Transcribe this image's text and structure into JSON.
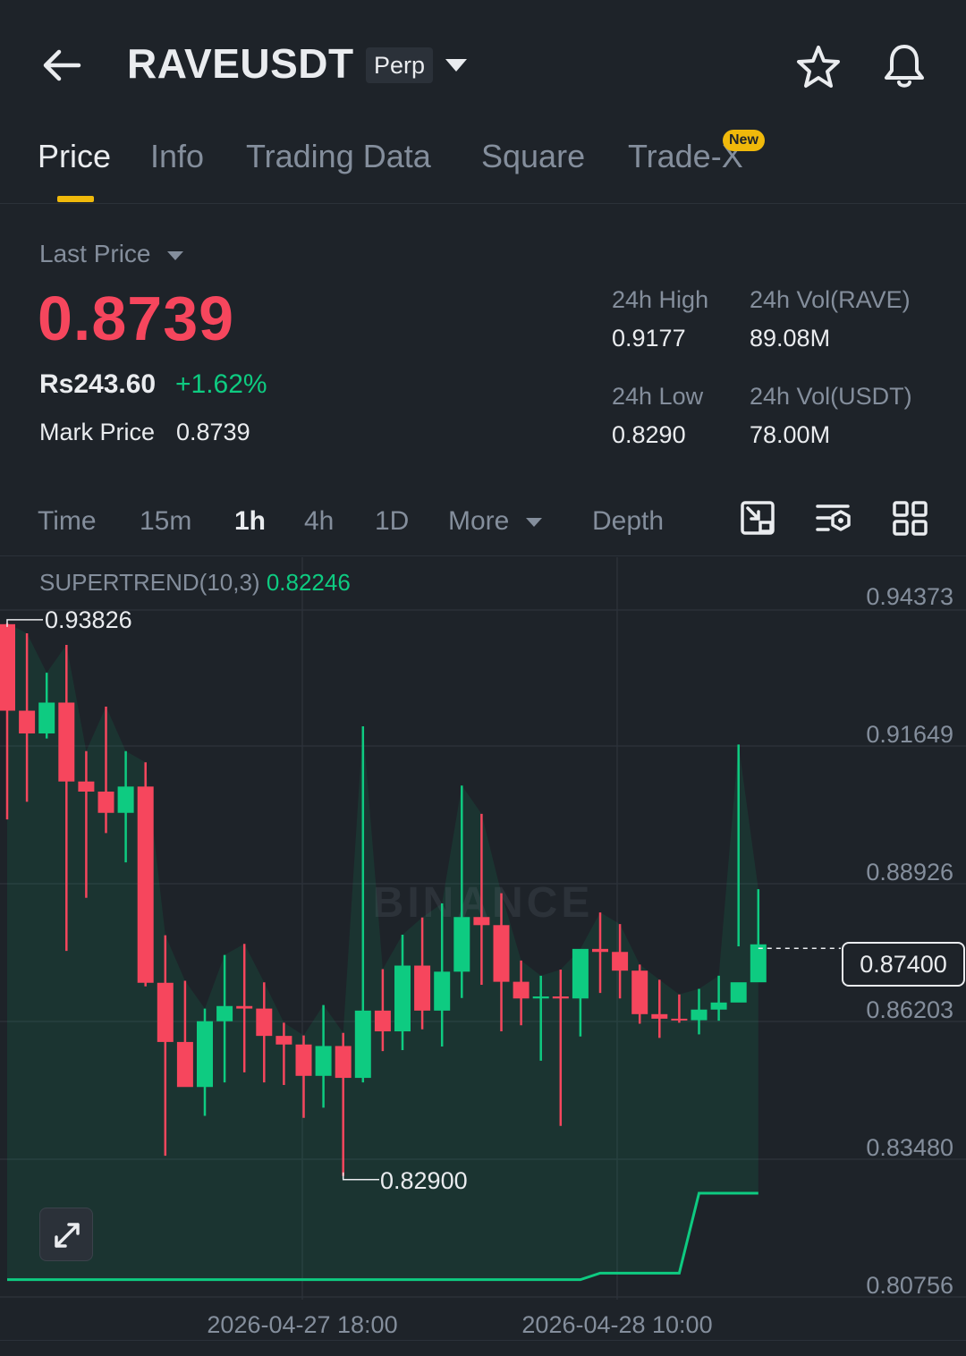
{
  "header": {
    "symbol": "RAVEUSDT",
    "contract_type": "Perp",
    "icons": [
      "back-arrow-icon",
      "chevron-down-icon",
      "star-icon",
      "bell-icon"
    ]
  },
  "tabs": [
    {
      "label": "Price",
      "active": true
    },
    {
      "label": "Info",
      "active": false
    },
    {
      "label": "Trading Data",
      "active": false
    },
    {
      "label": "Square",
      "active": false
    },
    {
      "label": "Trade-X",
      "active": false,
      "badge": "New"
    }
  ],
  "price_panel": {
    "label": "Last Price",
    "last_price": "0.8739",
    "fiat_value": "Rs243.60",
    "change_percent": "+1.62%",
    "mark_price_label": "Mark Price",
    "mark_price": "0.8739",
    "stats": {
      "high_label": "24h High",
      "high_value": "0.9177",
      "vol_base_label": "24h Vol(RAVE)",
      "vol_base_value": "89.08M",
      "low_label": "24h Low",
      "low_value": "0.8290",
      "vol_quote_label": "24h Vol(USDT)",
      "vol_quote_value": "78.00M"
    }
  },
  "intervals": {
    "items": [
      "Time",
      "15m",
      "1h",
      "4h",
      "1D",
      "More",
      "Depth"
    ],
    "active": "1h",
    "tool_icons": [
      "chart-tools-icon",
      "indicator-settings-icon",
      "layout-grid-icon"
    ]
  },
  "colors": {
    "up": "#0ecb81",
    "down": "#f6465d",
    "accent": "#f0b90b",
    "background": "#1e2329"
  },
  "chart_data": {
    "type": "candlestick",
    "indicator": {
      "name": "SUPERTREND(10,3)",
      "value": "0.82246"
    },
    "watermark": "BINANCE",
    "y_axis_ticks": [
      "0.94373",
      "0.91649",
      "0.88926",
      "0.86203",
      "0.83480",
      "0.80756"
    ],
    "ylim": [
      0.80756,
      0.94373
    ],
    "x_axis_ticks": [
      "2026-04-27 18:00",
      "2026-04-28 10:00"
    ],
    "current_price_tag": "0.87400",
    "high_annotation": "0.93826",
    "low_annotation": "0.82900",
    "candles": [
      {
        "o": 0.9381,
        "h": 0.9383,
        "l": 0.8995,
        "c": 0.921
      },
      {
        "o": 0.921,
        "h": 0.9363,
        "l": 0.903,
        "c": 0.9165
      },
      {
        "o": 0.9165,
        "h": 0.9285,
        "l": 0.9155,
        "c": 0.9226
      },
      {
        "o": 0.9226,
        "h": 0.934,
        "l": 0.8735,
        "c": 0.907
      },
      {
        "o": 0.907,
        "h": 0.913,
        "l": 0.884,
        "c": 0.905
      },
      {
        "o": 0.905,
        "h": 0.9218,
        "l": 0.8968,
        "c": 0.9008
      },
      {
        "o": 0.9008,
        "h": 0.913,
        "l": 0.891,
        "c": 0.906
      },
      {
        "o": 0.906,
        "h": 0.9108,
        "l": 0.8665,
        "c": 0.8672
      },
      {
        "o": 0.8672,
        "h": 0.8766,
        "l": 0.833,
        "c": 0.8555
      },
      {
        "o": 0.8555,
        "h": 0.8676,
        "l": 0.851,
        "c": 0.8466
      },
      {
        "o": 0.8466,
        "h": 0.8621,
        "l": 0.8409,
        "c": 0.8596
      },
      {
        "o": 0.8596,
        "h": 0.8727,
        "l": 0.8475,
        "c": 0.8626
      },
      {
        "o": 0.8626,
        "h": 0.8749,
        "l": 0.8495,
        "c": 0.8621
      },
      {
        "o": 0.8621,
        "h": 0.8673,
        "l": 0.8475,
        "c": 0.8567
      },
      {
        "o": 0.8567,
        "h": 0.8593,
        "l": 0.847,
        "c": 0.855
      },
      {
        "o": 0.855,
        "h": 0.8568,
        "l": 0.8405,
        "c": 0.8488
      },
      {
        "o": 0.8488,
        "h": 0.8628,
        "l": 0.8425,
        "c": 0.8547
      },
      {
        "o": 0.8547,
        "h": 0.8573,
        "l": 0.829,
        "c": 0.8484
      },
      {
        "o": 0.8484,
        "h": 0.9179,
        "l": 0.8475,
        "c": 0.8617
      },
      {
        "o": 0.8617,
        "h": 0.8699,
        "l": 0.8537,
        "c": 0.8576
      },
      {
        "o": 0.8576,
        "h": 0.8767,
        "l": 0.8539,
        "c": 0.8706
      },
      {
        "o": 0.8706,
        "h": 0.8801,
        "l": 0.858,
        "c": 0.8617
      },
      {
        "o": 0.8617,
        "h": 0.8829,
        "l": 0.8546,
        "c": 0.8694
      },
      {
        "o": 0.8694,
        "h": 0.9062,
        "l": 0.8642,
        "c": 0.8802
      },
      {
        "o": 0.8802,
        "h": 0.9006,
        "l": 0.8668,
        "c": 0.8786
      },
      {
        "o": 0.8786,
        "h": 0.8849,
        "l": 0.8576,
        "c": 0.8674
      },
      {
        "o": 0.8674,
        "h": 0.8716,
        "l": 0.8588,
        "c": 0.8641
      },
      {
        "o": 0.8641,
        "h": 0.8686,
        "l": 0.8518,
        "c": 0.8645
      },
      {
        "o": 0.8645,
        "h": 0.8698,
        "l": 0.8389,
        "c": 0.8641
      },
      {
        "o": 0.8641,
        "h": 0.8703,
        "l": 0.8566,
        "c": 0.8739
      },
      {
        "o": 0.8739,
        "h": 0.8811,
        "l": 0.8652,
        "c": 0.8733
      },
      {
        "o": 0.8733,
        "h": 0.8788,
        "l": 0.8641,
        "c": 0.8696
      },
      {
        "o": 0.8696,
        "h": 0.8708,
        "l": 0.8591,
        "c": 0.861
      },
      {
        "o": 0.861,
        "h": 0.8678,
        "l": 0.8563,
        "c": 0.8601
      },
      {
        "o": 0.8601,
        "h": 0.8649,
        "l": 0.8593,
        "c": 0.8598
      },
      {
        "o": 0.8598,
        "h": 0.866,
        "l": 0.857,
        "c": 0.8619
      },
      {
        "o": 0.8619,
        "h": 0.8686,
        "l": 0.8597,
        "c": 0.8633
      },
      {
        "o": 0.8633,
        "h": 0.9143,
        "l": 0.8744,
        "c": 0.8673
      },
      {
        "o": 0.8673,
        "h": 0.8857,
        "l": 0.8721,
        "c": 0.8748
      }
    ],
    "supertrend": [
      {
        "candle": 0,
        "value": 0.8085
      },
      {
        "candle": 29,
        "value": 0.8085
      },
      {
        "candle": 30,
        "value": 0.8098
      },
      {
        "candle": 34,
        "value": 0.8098
      },
      {
        "candle": 35,
        "value": 0.8256
      },
      {
        "candle": 38,
        "value": 0.8256
      }
    ]
  }
}
